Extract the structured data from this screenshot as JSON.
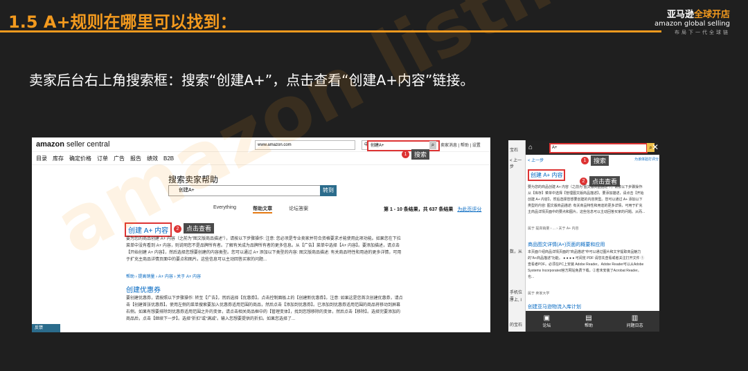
{
  "slide": {
    "title": "1.5 A+规则在哪里可以找到：",
    "subtitle": "卖家后台右上角搜索框：搜索“创建A+”，点击查看“创建A+内容”链接。",
    "watermark": "amazon listing",
    "colors": {
      "accent": "#f39a1e",
      "background": "#1f1f1f"
    }
  },
  "logo": {
    "line1a": "亚马逊",
    "line1b": "全球开店",
    "line2": "amazon global selling",
    "line3": "布局下一代全球链"
  },
  "left_shot": {
    "brand": "amazon",
    "brand_suffix": " seller central",
    "url": "www.amazon.com",
    "lang": "中文",
    "search_value": "创建A+",
    "header_links": "卖家消息 | 帮助 | 设置",
    "nav": [
      "目录",
      "库存",
      "确定价格",
      "订单",
      "广告",
      "报告",
      "绩效",
      "B2B"
    ],
    "search_badge": "1",
    "search_tag": "搜索",
    "help_heading": "搜索卖家帮助",
    "help_query": "创建A+",
    "help_button": "转到",
    "tabs": [
      "Everything",
      "帮助文章",
      "论坛答案"
    ],
    "results_count": "第 1 - 10 条结果，共 637 条结果",
    "feedback_link": "为此页评分",
    "result1_title": "创建 A+ 内容",
    "result1_badge": "2",
    "result1_tag": "点击查看",
    "result1_text": "要为您的商品创建 A+ 内容（之前为\"图文版商品描述\"），请按以下步骤操作: 注意: 您必须是专业卖家并符合资格要求才能使用此项功能。如果您在下拉菜单中没有看到 A+ 内容，则说明您不是品牌所有者。了解有关成为品牌所有者的更多信息。从【广告】菜单中选择【A+ 内容】。要添加描述，请点击【开始创建 A+ 内容】，然后选择您想要创建的内容类型。您可以通过 A+ 添加以下类型的内容: 图文版商品描述: 有关商品特性和用途的更多详情，可用于扩充主商品详情页面中的要点和图片。这些信息可以主动回答买家的问题...",
    "result1_breadcrumb": "帮助 › 提高销量 › A+ 内容 › 关于 A+ 内容",
    "result2_title": "创建优惠券",
    "result2_text": "要创建优惠券，请按照以下步骤操作: 转至【广告】，然后选择【优惠券】。点击控制面板上的【创建新优惠券】。注意: 如果这是您首次创建优惠券，请点击【创建首张优惠券】。使用左侧的菜单搜索要加入优惠券适用范围的商品，然后点击【添加到优惠券】。已添加到优惠券适用范围的商品将移动到屏幕右侧。如果有想要排除到优惠券适用范围之外的变体，请点击相关商品框中的【管理变体】，找到您想移除的变体，然后点击【移除】。选择完要添加的商品后，点击【继续下一步】。选择“折扣”或“满减”。输入您想要提供的折扣。如果您选择了...",
    "feedback": "反馈"
  },
  "right_shot": {
    "strip_texts": [
      "宝石",
      "< 上一步",
      "数，从",
      "手机位于",
      "序上, I",
      "的宝石"
    ],
    "search_value": "A+",
    "search_badge": "1",
    "search_tag": "搜索",
    "back": "< 上一步",
    "rate": "为该体验打评分",
    "result1_title": "创建 A+ 内容",
    "result1_badge": "2",
    "result1_tag": "点击查看",
    "result1_text": "要为您的商品创建 A+ 内容（之前为\"图文版商品描述\"），请按以下步骤操作: 从【库存】菜单中选择【管理图文版商品描述】，要添加描述，请点击【开始创建 A+ 内容】，然后选择您想要创建的内容类型。您可以通过 A+ 添加以下类型的内容: 图文版商品描述: 有关商品特性和用途的更多详情，可用于扩充主商品详情页面中的要点和图片。这些信息可以主动回答买家的问题。从而...",
    "result1_crumb": "属于 提高销量 › ... › 关于 A+ 内容",
    "result2_title": "商品图文详情(A+)页面的概要和应用",
    "result2_text": "本页面介绍商品详情页面的\"商品描述\"中可以通过图片和文字提取商品魅力的\"A+商品描述\"功能。 ● ● ● ● 可阅览 PDF 请您先查看或者关注打开文件 ①查看者PDF。必须在PC上安装 Adobe Reader。Adobe Reader可以从Adobe Systems Incorporated官方网站免费下载。②若未安装了Acrobat Reader。也...",
    "result2_crumb": "属于 卖家大学",
    "result3_title": "创建亚马逊物流入库计划",
    "footer": [
      "论坛",
      "帮助",
      "问题日志"
    ]
  }
}
